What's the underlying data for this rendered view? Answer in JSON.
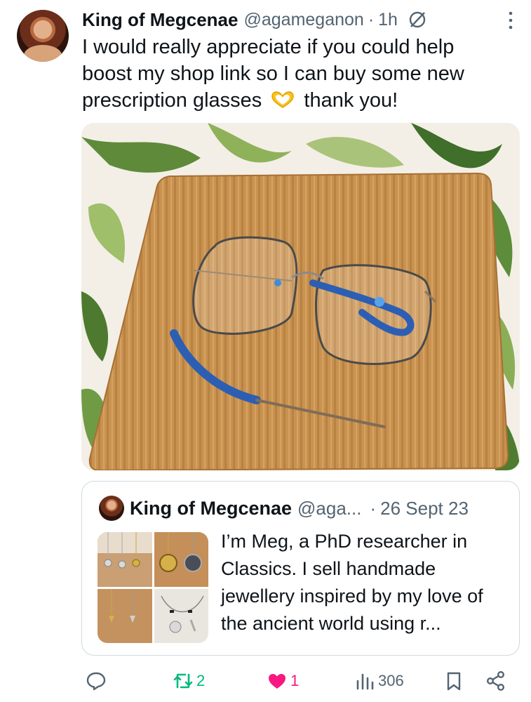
{
  "tweet": {
    "author_name": "King of Megcenae",
    "author_handle": "@agameganon",
    "separator": "·",
    "time": "1h",
    "text_line1": "I would really appreciate if you could help",
    "text_line2": "boost my shop link so I can buy some new",
    "text_line3a": "prescription glasses",
    "text_line3b": "thank you!",
    "emoji": "heart-hands"
  },
  "quote": {
    "author_name": "King of Megcenae",
    "author_handle": "@aga...",
    "separator": "·",
    "date": "26 Sept 23",
    "text": "I’m Meg, a PhD researcher in Classics. I sell handmade jewellery inspired by my love of the ancient world using r..."
  },
  "actions": {
    "reply": {
      "icon": "reply-icon",
      "count": ""
    },
    "retweet": {
      "icon": "retweet-icon",
      "count": "2",
      "color": "#00ba7c"
    },
    "like": {
      "icon": "heart-icon",
      "count": "1",
      "color": "#f91880"
    },
    "views": {
      "icon": "views-icon",
      "count": "306"
    },
    "bookmark": {
      "icon": "bookmark-icon"
    },
    "share": {
      "icon": "share-icon"
    }
  },
  "colors": {
    "text": "#0f1419",
    "secondary": "#536471",
    "border": "#cfd9de"
  }
}
